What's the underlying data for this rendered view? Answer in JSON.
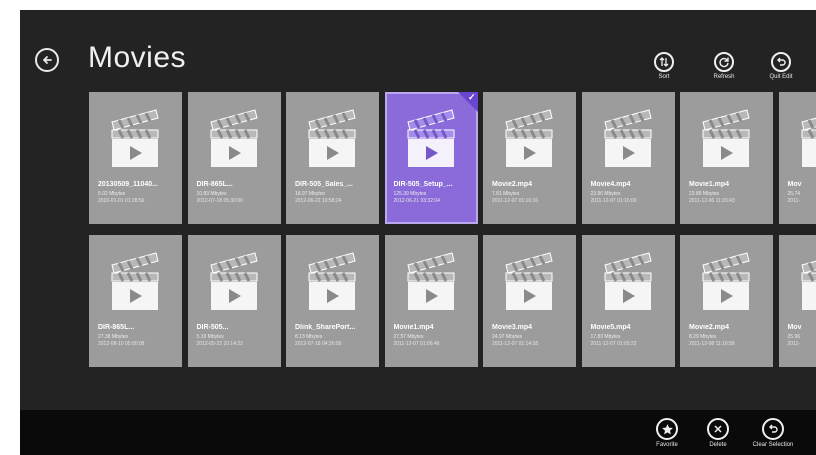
{
  "page": {
    "title": "Movies"
  },
  "top_commands": {
    "sort": {
      "label": "Sort",
      "icon": "sort-icon"
    },
    "refresh": {
      "label": "Refresh",
      "icon": "refresh-icon"
    },
    "quit_edit": {
      "label": "Quit Edit",
      "icon": "undo-icon"
    }
  },
  "tiles": [
    {
      "name": "20130509_11040...",
      "size": "5.02 Mbytes",
      "date": "2010-01-01 01:28:56",
      "selected": false
    },
    {
      "name": "DIR-865L...",
      "size": "10.83 Mbytes",
      "date": "2012-07-18 05:30:00",
      "selected": false
    },
    {
      "name": "DIR-505_Sales_...",
      "size": "18.97 Mbytes",
      "date": "2012-06-22 10:58:24",
      "selected": false
    },
    {
      "name": "DIR-505_Setup_...",
      "size": "125.39 Mbytes",
      "date": "2012-06-21 03:32:04",
      "selected": true
    },
    {
      "name": "Movie2.mp4",
      "size": "7.81 Mbytes",
      "date": "2011-12-07 01:16:16",
      "selected": false
    },
    {
      "name": "Movie4.mp4",
      "size": "23.96 Mbytes",
      "date": "2011-12-07 01:16:00",
      "selected": false
    },
    {
      "name": "Movie1.mp4",
      "size": "23.89 Mbytes",
      "date": "2011-12-06 11:20:43",
      "selected": false
    },
    {
      "name": "Mov",
      "size": "25.74",
      "date": "2011-",
      "selected": false
    },
    {
      "name": "DIR-865L...",
      "size": "27.38 Mbytes",
      "date": "2012-08-10 05:00:08",
      "selected": false
    },
    {
      "name": "DIR-505...",
      "size": "5.10 Mbytes",
      "date": "2012-05-22 10:14:22",
      "selected": false
    },
    {
      "name": "Dlink_SharePort...",
      "size": "8.13 Mbytes",
      "date": "2012-07-18 04:26:00",
      "selected": false
    },
    {
      "name": "Movie1.mp4",
      "size": "27.57 Mbytes",
      "date": "2011-12-07 01:06:46",
      "selected": false
    },
    {
      "name": "Movie3.mp4",
      "size": "24.97 Mbytes",
      "date": "2011-12-07 01:14:18",
      "selected": false
    },
    {
      "name": "Movie5.mp4",
      "size": "17.83 Mbytes",
      "date": "2011-12-07 01:05:22",
      "selected": false
    },
    {
      "name": "Movie2.mp4",
      "size": "8.29 Mbytes",
      "date": "2011-12-08 11:16:58",
      "selected": false
    },
    {
      "name": "Mov",
      "size": "25.96",
      "date": "2011-",
      "selected": false
    }
  ],
  "bottom_commands": {
    "favorite": {
      "label": "Favorite",
      "icon": "star-icon"
    },
    "delete": {
      "label": "Delete",
      "icon": "close-icon"
    },
    "clear_selection": {
      "label": "Clear Selection",
      "icon": "undo-icon"
    }
  },
  "colors": {
    "background": "#232323",
    "tile": "#9c9c9c",
    "selected_tile": "#8a6bd9",
    "app_bar": "#0a0a0a"
  }
}
